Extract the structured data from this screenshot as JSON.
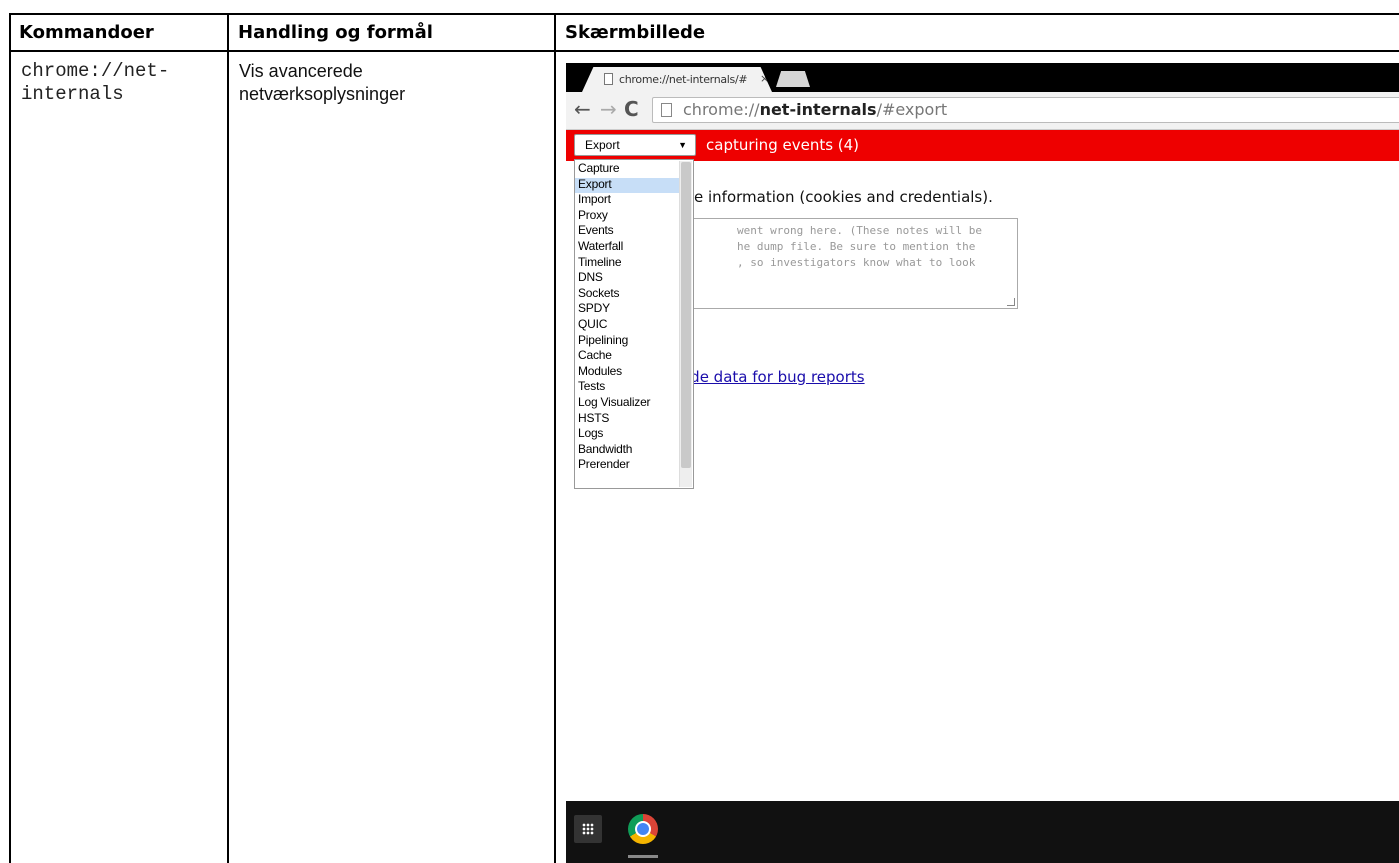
{
  "table": {
    "headers": [
      "Kommandoer",
      "Handling og formål",
      "Skærmbillede"
    ],
    "row": {
      "command_line1": "chrome://net-",
      "command_line2": "internals",
      "action_line1": "Vis avancerede",
      "action_line2": "netværksoplysninger"
    }
  },
  "screenshot": {
    "tab_title": "chrome://net-internals/#",
    "tab_close": "×",
    "url_prefix": "chrome://",
    "url_host": "net-internals",
    "url_path": "/#export",
    "select_value": "Export",
    "capture_status": "capturing events (4)",
    "menu_items": [
      "Capture",
      "Export",
      "Import",
      "Proxy",
      "Events",
      "Waterfall",
      "Timeline",
      "DNS",
      "Sockets",
      "SPDY",
      "QUIC",
      "Pipelining",
      "Cache",
      "Modules",
      "Tests",
      "Log Visualizer",
      "HSTS",
      "Logs",
      "Bandwidth",
      "Prerender"
    ],
    "selected_item": "Export",
    "privacy_text": "e information (cookies and credentials).",
    "notes_line1": "went wrong here. (These notes will be",
    "notes_line2": "he dump file. Be sure to mention the",
    "notes_line3": ", so investigators know what to look",
    "bug_link": "ide data for bug reports"
  }
}
